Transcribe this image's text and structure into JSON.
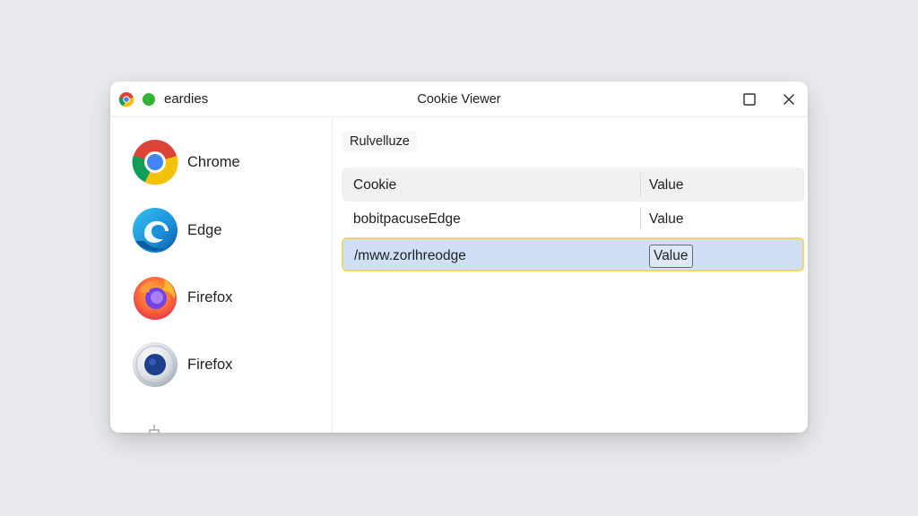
{
  "window": {
    "app_name": "eardies",
    "title": "Cookie Viewer",
    "icons": [
      "chrome-icon",
      "green-dot-icon",
      "maximize-icon",
      "close-icon"
    ]
  },
  "sidebar": {
    "items": [
      {
        "label": "Chrome",
        "icon": "chrome-logo-icon"
      },
      {
        "label": "Edge",
        "icon": "edge-logo-icon"
      },
      {
        "label": "Firefox",
        "icon": "firefox-logo-icon"
      },
      {
        "label": "Firefox",
        "icon": "blue-globe-logo-icon"
      }
    ]
  },
  "main": {
    "filter_label": "Rulvelluze",
    "table": {
      "columns": [
        "Cookie",
        "Value"
      ],
      "rows": [
        {
          "cookie": "bobitpacuseEdge",
          "value": "Value"
        },
        {
          "cookie": "/mww.zorlhreodge",
          "value": "Value"
        }
      ],
      "selected_row": 1
    }
  },
  "colors": {
    "background": "#e9eaed",
    "selection": "#cfe0f6",
    "selection_border": "#efd56a"
  }
}
